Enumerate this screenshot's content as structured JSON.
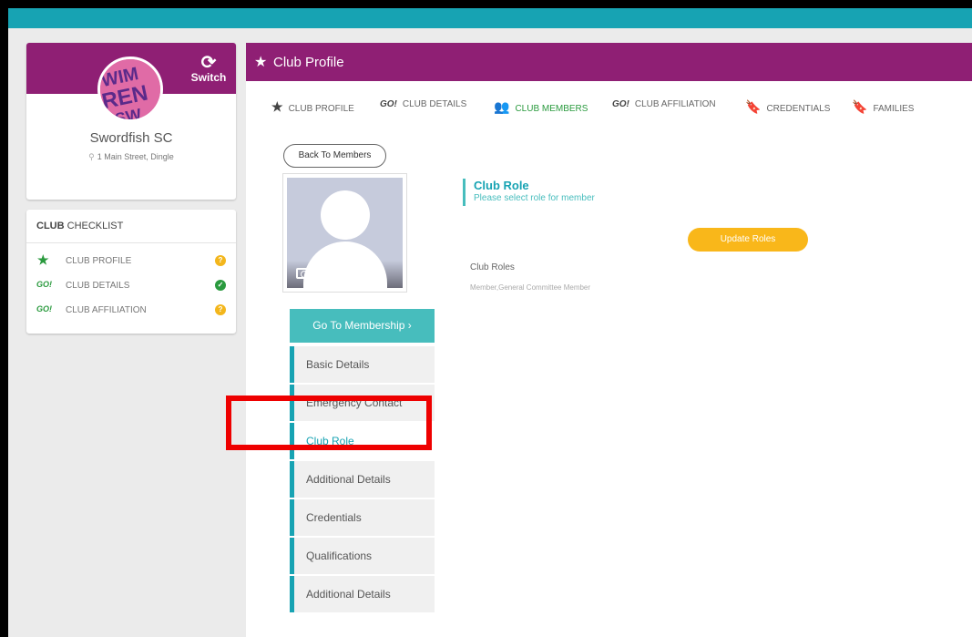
{
  "club": {
    "name": "Swordfish SC",
    "address": "1 Main Street, Dingle",
    "switch_label": "Switch"
  },
  "checklist": {
    "title_bold": "CLUB",
    "title_rest": " CHECKLIST",
    "items": [
      {
        "icon_text": "GO!",
        "label": "CLUB PROFILE",
        "status": "pending"
      },
      {
        "icon_text": "GO!",
        "label": "CLUB DETAILS",
        "status": "done"
      },
      {
        "icon_text": "GO!",
        "label": "CLUB AFFILIATION",
        "status": "pending"
      }
    ]
  },
  "header": {
    "title": "Club Profile"
  },
  "tabs": [
    {
      "icon_text": "★",
      "label": "CLUB PROFILE"
    },
    {
      "icon_text": "GO!",
      "label": "CLUB DETAILS"
    },
    {
      "icon_text": "👥",
      "label": "CLUB MEMBERS",
      "active": true
    },
    {
      "icon_text": "GO!",
      "label": "CLUB AFFILIATION"
    },
    {
      "icon_text": "🔖",
      "label": "CREDENTIALS"
    },
    {
      "icon_text": "🔖",
      "label": "FAMILIES"
    }
  ],
  "back_button": "Back To Members",
  "membership_button": "Go To Membership ›",
  "side_nav": [
    {
      "label": "Basic Details"
    },
    {
      "label": "Emergency Contact"
    },
    {
      "label": "Club Role",
      "active": true
    },
    {
      "label": "Additional Details"
    },
    {
      "label": "Credentials"
    },
    {
      "label": "Qualifications"
    },
    {
      "label": "Additional Details"
    }
  ],
  "role_panel": {
    "title": "Club Role",
    "subtitle": "Please select role for member",
    "update_button": "Update Roles",
    "roles_label": "Club Roles",
    "roles_value": "Member,General Committee Member"
  },
  "colors": {
    "brand_purple": "#8f1f74",
    "teal": "#17a3b3",
    "green": "#2a9a3e",
    "amber": "#f9b71a",
    "highlight_red": "#ee0000"
  }
}
